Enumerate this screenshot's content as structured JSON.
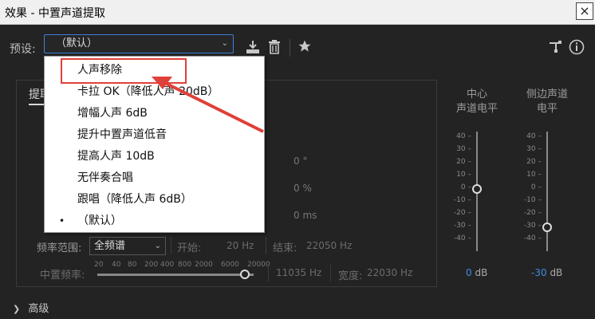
{
  "window": {
    "title": "效果 - 中置声道提取",
    "close_label": "×"
  },
  "toolbar": {
    "preset_label": "预设:",
    "preset_value": "（默认）",
    "icons": [
      "download-icon",
      "trash-icon",
      "star-icon",
      "route-icon",
      "info-icon"
    ]
  },
  "tab": {
    "label": "提取"
  },
  "panel": {
    "value_degree": "0 °",
    "value_percent": "0 %",
    "value_ms": "0 ms"
  },
  "frequency": {
    "range_label": "频率范围:",
    "range_value": "全频谱",
    "start_label": "开始:",
    "start_value": "20 Hz",
    "end_label": "结束:",
    "end_value": "22050 Hz",
    "center_label": "中置频率:",
    "center_value": "11035 Hz",
    "width_label": "宽度:",
    "width_value": "22030 Hz",
    "scale": [
      "20",
      "40",
      "80",
      "200",
      "400",
      "800",
      "2000",
      "6000",
      "20000"
    ]
  },
  "meters": {
    "center": {
      "title_line1": "中心",
      "title_line2": "声道电平",
      "value": "0",
      "unit": "dB"
    },
    "side": {
      "title_line1": "侧边声道",
      "title_line2": "电平",
      "value": "-30",
      "unit": "dB"
    },
    "ticks": [
      "40",
      "30",
      "20",
      "10",
      "0",
      "-10",
      "-20",
      "-30",
      "-40"
    ]
  },
  "advanced_label": "高级",
  "dropdown": {
    "items": [
      {
        "label": "人声移除",
        "selected": false
      },
      {
        "label": "卡拉 OK（降低人声 20dB）",
        "selected": false
      },
      {
        "label": "增幅人声 6dB",
        "selected": false
      },
      {
        "label": "提升中置声道低音",
        "selected": false
      },
      {
        "label": "提高人声 10dB",
        "selected": false
      },
      {
        "label": "无伴奏合唱",
        "selected": false
      },
      {
        "label": "跟唱（降低人声 6dB）",
        "selected": false
      },
      {
        "label": "（默认）",
        "selected": true
      }
    ],
    "bullet": "•"
  },
  "colors": {
    "accent": "#3d8ee0",
    "annotation": "#e0403a",
    "focus_border": "#3f7fd9"
  }
}
